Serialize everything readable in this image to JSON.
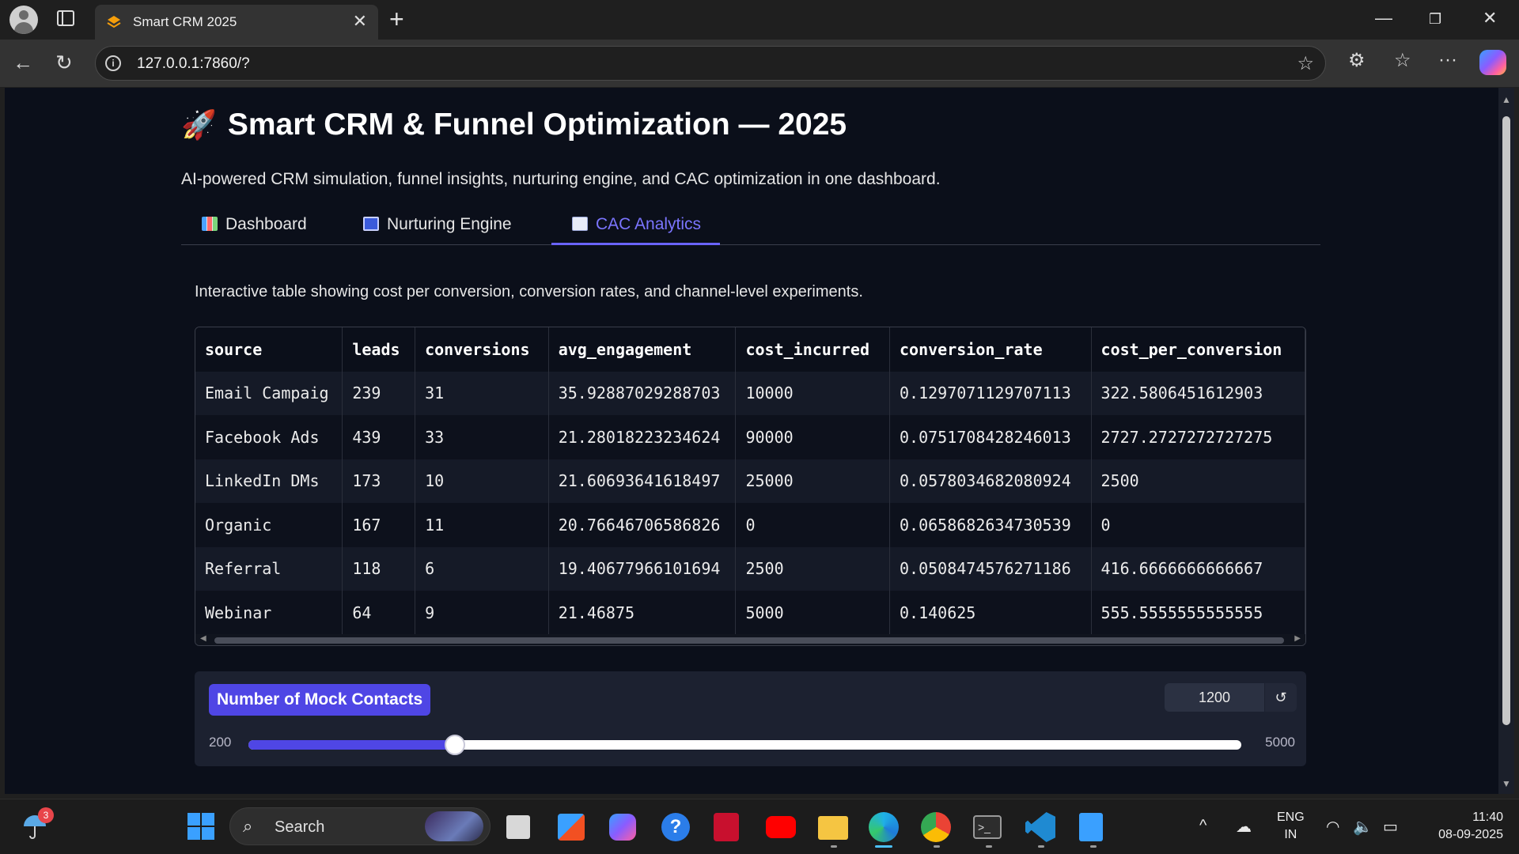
{
  "browser": {
    "tab_title": "Smart CRM 2025",
    "url": "127.0.0.1:7860/?"
  },
  "page": {
    "title": "Smart CRM & Funnel Optimization — 2025",
    "title_icon": "🚀",
    "subtitle": "AI-powered CRM simulation, funnel insights, nurturing engine, and CAC optimization in one dashboard.",
    "tabs": [
      {
        "label": "Dashboard",
        "icon": "bar-chart-icon",
        "active": false
      },
      {
        "label": "Nurturing Engine",
        "icon": "camera-icon",
        "active": false
      },
      {
        "label": "CAC Analytics",
        "icon": "trend-chart-icon",
        "active": true
      }
    ],
    "description": "Interactive table showing cost per conversion, conversion rates, and channel-level experiments."
  },
  "table": {
    "columns": [
      "source",
      "leads",
      "conversions",
      "avg_engagement",
      "cost_incurred",
      "conversion_rate",
      "cost_per_conversion"
    ],
    "rows": [
      [
        "Email Campaig",
        "239",
        "31",
        "35.92887029288703",
        "10000",
        "0.1297071129707113",
        "322.5806451612903"
      ],
      [
        "Facebook Ads",
        "439",
        "33",
        "21.28018223234624",
        "90000",
        "0.0751708428246013",
        "2727.2727272727275"
      ],
      [
        "LinkedIn DMs",
        "173",
        "10",
        "21.60693641618497",
        "25000",
        "0.0578034682080924",
        "2500"
      ],
      [
        "Organic",
        "167",
        "11",
        "20.76646706586826",
        "0",
        "0.0658682634730539",
        "0"
      ],
      [
        "Referral",
        "118",
        "6",
        "19.40677966101694",
        "2500",
        "0.0508474576271186",
        "416.6666666666667"
      ],
      [
        "Webinar",
        "64",
        "9",
        "21.46875",
        "5000",
        "0.140625",
        "555.5555555555555"
      ]
    ]
  },
  "slider": {
    "label": "Number of Mock Contacts",
    "value": "1200",
    "value_num": 1200,
    "min": "200",
    "max": "5000",
    "min_num": 200,
    "max_num": 5000,
    "reset_glyph": "↺"
  },
  "taskbar": {
    "weather_badge": "3",
    "search_placeholder": "Search",
    "lang_top": "ENG",
    "lang_bottom": "IN",
    "time": "11:40",
    "date": "08-09-2025"
  },
  "colors": {
    "accent": "#4f46e5",
    "active_tab": "#7b75ff",
    "page_bg": "#0b0f1a"
  }
}
